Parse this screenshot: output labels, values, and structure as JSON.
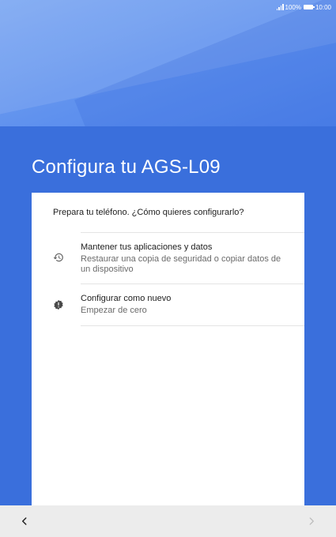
{
  "status_bar": {
    "battery_level": "100%",
    "time": "10:00"
  },
  "header": {
    "title": "Configura tu AGS-L09"
  },
  "card": {
    "heading": "Prepara tu teléfono. ¿Cómo quieres configurarlo?",
    "options": [
      {
        "icon": "restore-history-icon",
        "title": "Mantener tus aplicaciones y datos",
        "subtitle": "Restaurar una copia de seguridad o copiar datos de un dispositivo"
      },
      {
        "icon": "new-setup-badge-icon",
        "title": "Configurar como nuevo",
        "subtitle": "Empezar de cero"
      }
    ]
  },
  "navigation": {
    "back_icon": "chevron-left-icon",
    "forward_icon": "chevron-right-icon",
    "back_color": "#222222",
    "forward_color": "#bdbdbd"
  },
  "colors": {
    "accent": "#3a6fdc",
    "card_background": "#ffffff",
    "nav_background": "#ececec"
  }
}
